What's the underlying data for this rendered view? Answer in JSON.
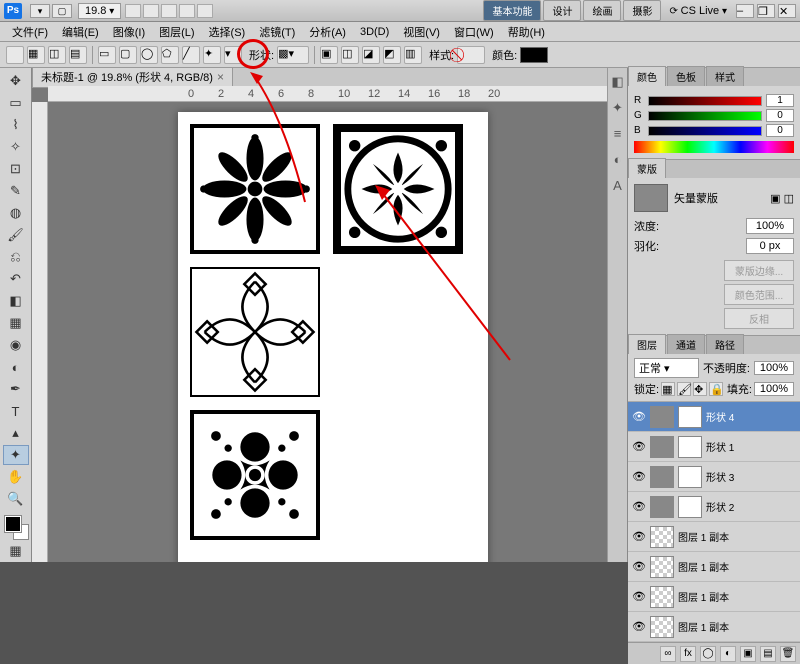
{
  "app": {
    "logo": "Ps",
    "zoom": "19.8"
  },
  "workspace_tabs": [
    "基本功能",
    "设计",
    "绘画",
    "摄影"
  ],
  "cslive": "CS Live",
  "menu": [
    "文件(F)",
    "编辑(E)",
    "图像(I)",
    "图层(L)",
    "选择(S)",
    "滤镜(T)",
    "分析(A)",
    "3D(D)",
    "视图(V)",
    "窗口(W)",
    "帮助(H)"
  ],
  "optbar": {
    "shape_label": "形状:",
    "style_label": "样式:",
    "color_label": "颜色:"
  },
  "doc_tab": "未标题-1 @ 19.8% (形状 4, RGB/8)",
  "ruler_marks": [
    "0",
    "2",
    "4",
    "6",
    "8",
    "10",
    "12",
    "14",
    "16",
    "18",
    "20"
  ],
  "color_panel": {
    "tabs": [
      "颜色",
      "色板",
      "样式"
    ],
    "r": "1",
    "g": "0",
    "b": "0"
  },
  "mask_panel": {
    "tab": "蒙版",
    "title": "矢量蒙版",
    "density_label": "浓度:",
    "density": "100%",
    "feather_label": "羽化:",
    "feather": "0 px",
    "btn1": "蒙版边缘...",
    "btn2": "颜色范围...",
    "btn3": "反相"
  },
  "layers_panel": {
    "tabs": [
      "图层",
      "通道",
      "路径"
    ],
    "blend": "正常",
    "opacity_label": "不透明度:",
    "opacity": "100%",
    "lock_label": "锁定:",
    "fill_label": "填充:",
    "fill": "100%",
    "layers": [
      {
        "name": "形状 4",
        "sel": true,
        "shape": true
      },
      {
        "name": "形状 1",
        "shape": true
      },
      {
        "name": "形状 3",
        "shape": true
      },
      {
        "name": "形状 2",
        "shape": true
      },
      {
        "name": "图层 1 副本"
      },
      {
        "name": "图层 1 副本"
      },
      {
        "name": "图层 1 副本"
      },
      {
        "name": "图层 1 副本"
      }
    ]
  },
  "strip_icons": [
    "◧",
    "✦",
    "≡",
    "◐",
    "A"
  ]
}
